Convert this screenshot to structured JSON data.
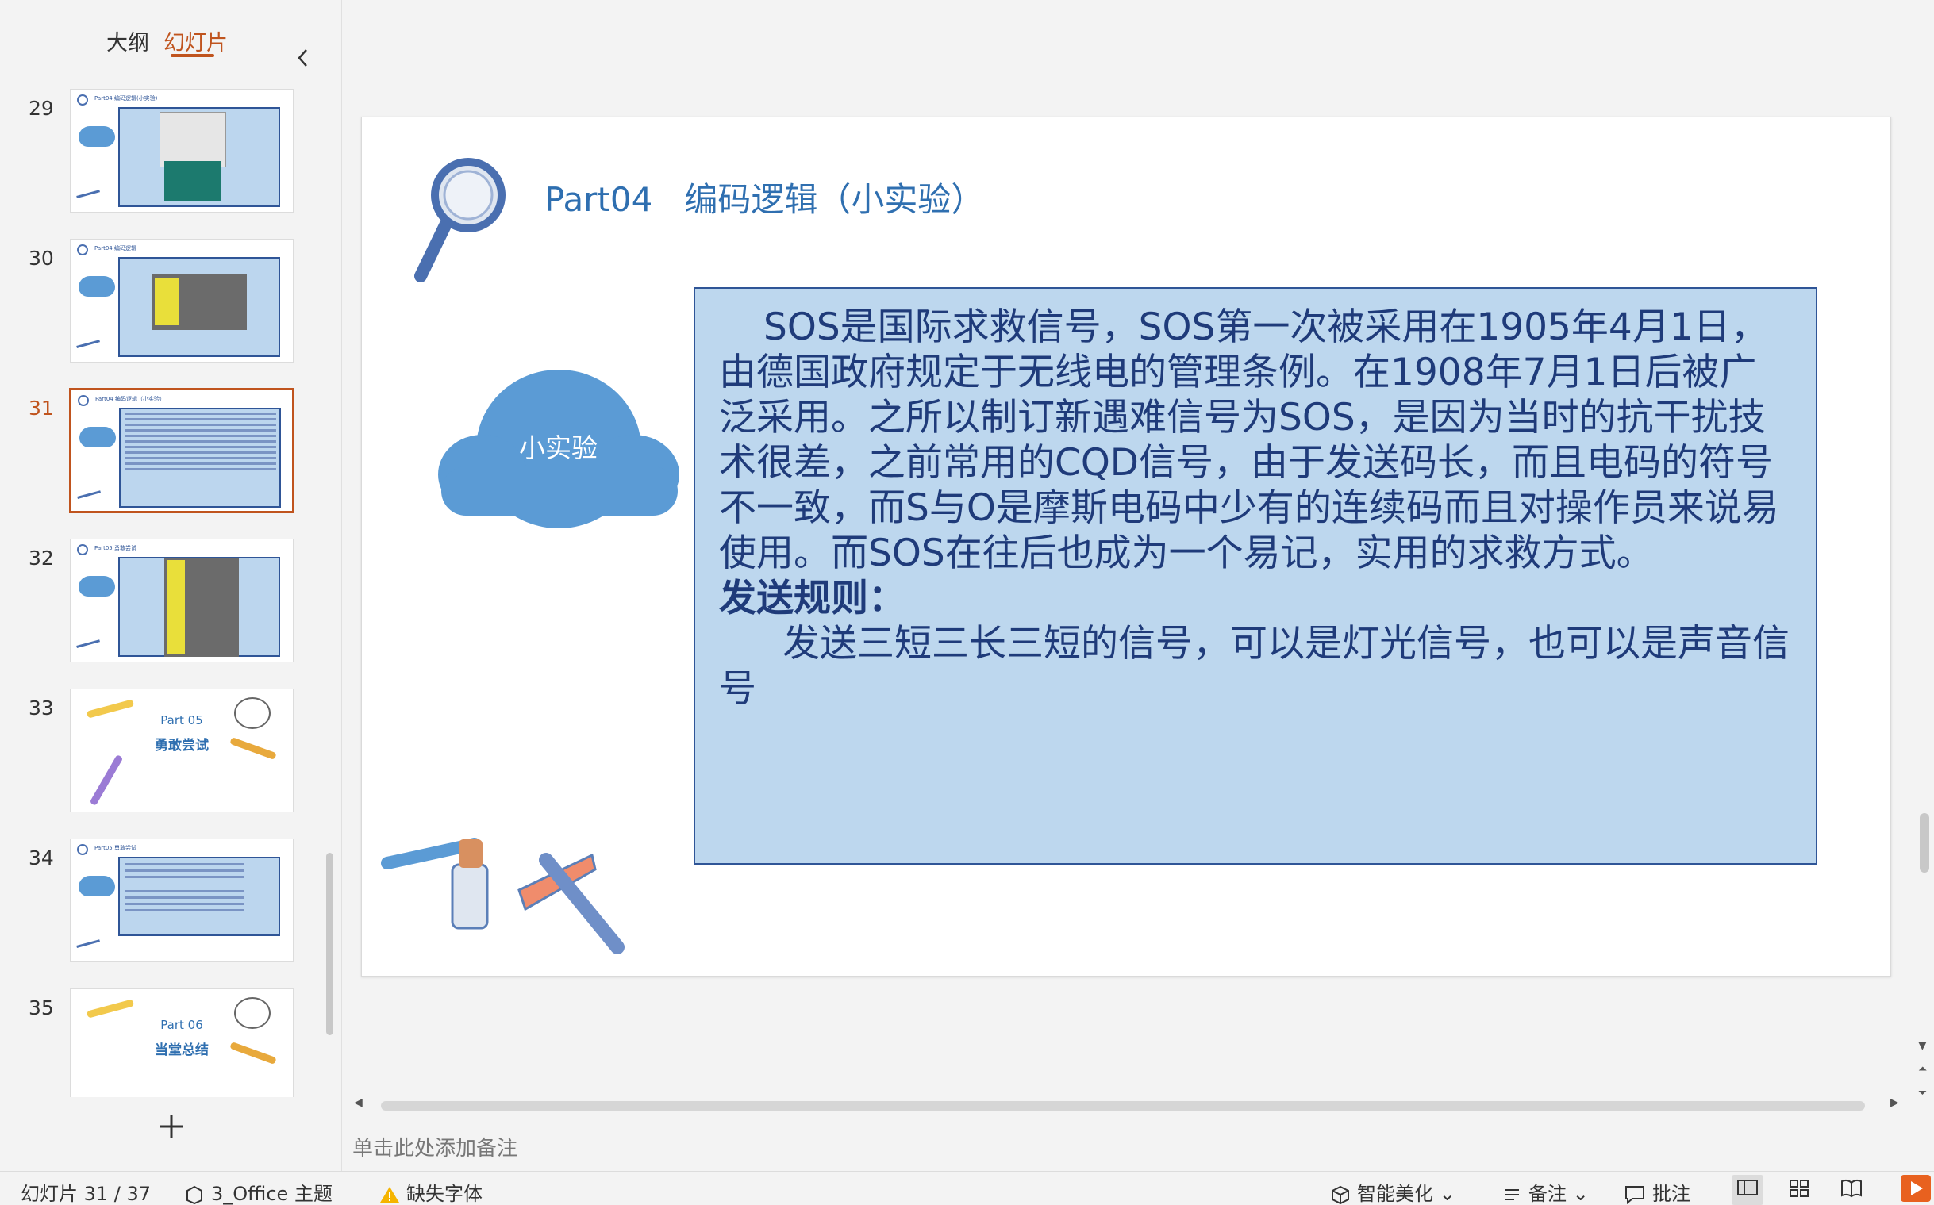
{
  "panel": {
    "tab_outline": "大纲",
    "tab_slides": "幻灯片"
  },
  "thumbnails": [
    {
      "num": "29",
      "title": "Part04 编码逻辑(小实验)"
    },
    {
      "num": "30",
      "title": "Part04 编码逻辑"
    },
    {
      "num": "31",
      "title": "Part04 编码逻辑（小实验）"
    },
    {
      "num": "32",
      "title": "Part05 勇敢尝试"
    },
    {
      "num": "33",
      "cover_title": "Part 05",
      "cover_sub": "勇敢尝试"
    },
    {
      "num": "34",
      "title": "Part05 勇敢尝试"
    },
    {
      "num": "35",
      "cover_title": "Part 06",
      "cover_sub": "当堂总结"
    }
  ],
  "slide": {
    "title": "Part04   编码逻辑（小实验）",
    "cloud_label": "小实验",
    "paragraph": "SOS是国际求救信号，SOS第一次被采用在1905年4月1日，由德国政府规定于无线电的管理条例。在1908年7月1日后被广泛采用。之所以制订新遇难信号为SOS，是因为当时的抗干扰技术很差，之前常用的CQD信号，由于发送码长，而且电码的符号不一致，而S与O是摩斯电码中少有的连续码而且对操作员来说易使用。而SOS在往后也成为一个易记，实用的求救方式。",
    "rule_heading": "发送规则：",
    "rule_body": "发送三短三长三短的信号，可以是灯光信号，也可以是声音信号"
  },
  "notes_placeholder": "单击此处添加备注",
  "statusbar": {
    "slide_counter": "幻灯片 31 / 37",
    "theme": "3_Office 主题",
    "missing_font": "缺失字体",
    "smart_beautify": "智能美化",
    "notes": "备注",
    "comments": "批注"
  },
  "colors": {
    "accent": "#c0541e",
    "slide_title": "#2f6fb0",
    "text_box_fill": "#bdd7ee",
    "text_box_border": "#2f5597",
    "cloud": "#5b9bd5"
  }
}
